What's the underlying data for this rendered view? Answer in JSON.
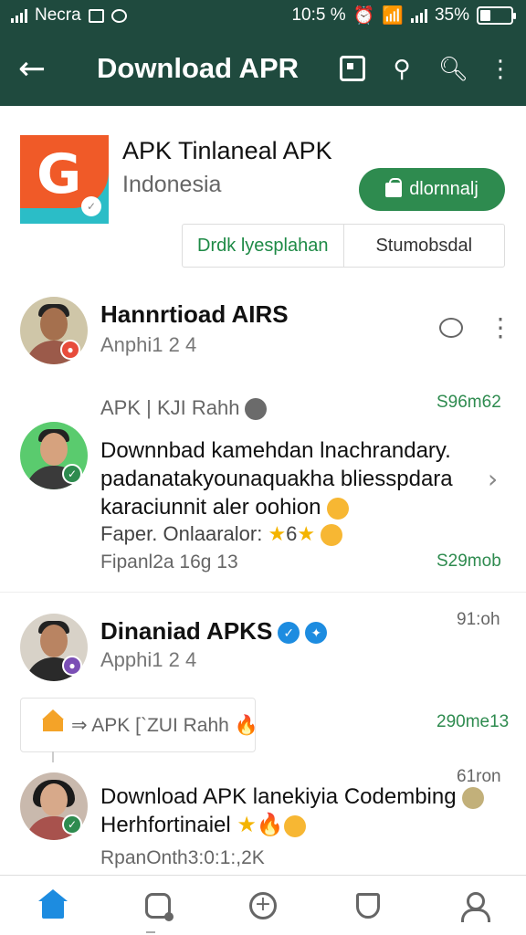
{
  "status_bar": {
    "carrier": "Necra",
    "clock": "10:5 %",
    "battery": "35%",
    "battery_level": 0.35
  },
  "app_bar": {
    "back_icon": "arrow-left-icon",
    "title": "Download APR",
    "actions": [
      "image-box-icon",
      "share-icon",
      "search-icon",
      "more-vert-icon"
    ]
  },
  "app_header": {
    "name": "APK Tinlaneal APK",
    "country": "Indonesia",
    "download_label": "dlornnalj",
    "tabs": [
      "Drdk lyesplahan",
      "Stumobsdal"
    ]
  },
  "posts": [
    {
      "name": "Hannrtioad AIRS",
      "sub": "Anphi1 2 4"
    },
    {
      "heading": "APK | KJI Rahh",
      "heading_count": "S96m62",
      "text_line_1": "Downnbad kamehdan lnachrandary.",
      "text_line_2": "padanatakyounaquakha bliesspdara",
      "text_line_3": "karaciunnit aler oohion",
      "meta_1": "Faper. Onlaaralor:",
      "meta_1_value": "6",
      "meta_2": "Fipanl2a 16g 13",
      "meta_2_count": "S29mob"
    },
    {
      "name": "Dinaniad APKS",
      "sub": "Apphi1 2 4",
      "time": "91:oh",
      "quote_heading": "APK [`ZUI Rahh",
      "quote_count": "290me13"
    },
    {
      "time": "61ron",
      "text_line_1": "Download APK lanekiyia Codembing",
      "text_line_2": "Herhfortinaiel",
      "meta": "RpanOnth3:0:1:,2K"
    }
  ],
  "bottom_nav": [
    "home-icon",
    "chat-icon",
    "add-icon",
    "shield-icon",
    "profile-icon"
  ],
  "colors": {
    "header_bg": "#1f4a3e",
    "accent_green": "#2e8b4f",
    "verified_blue": "#1d8ce0"
  }
}
